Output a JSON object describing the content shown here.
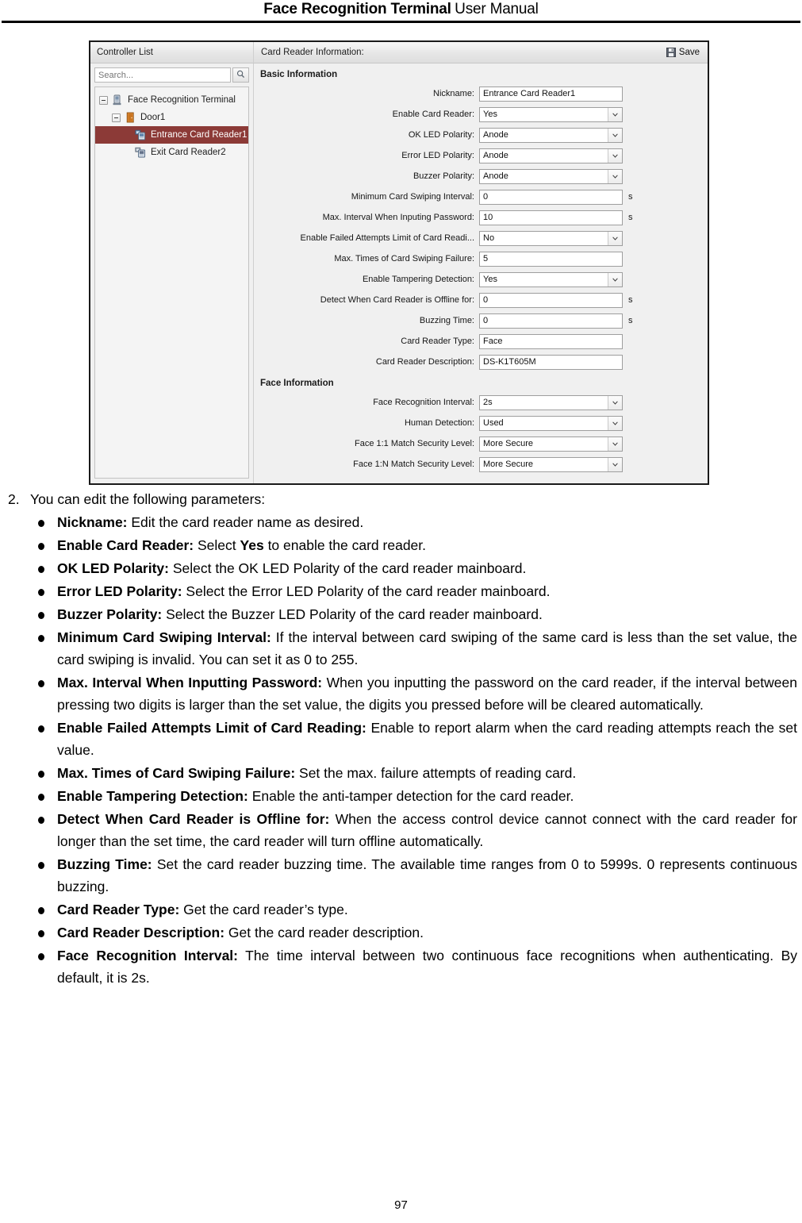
{
  "document": {
    "header_title_bold": "Face Recognition Terminal",
    "header_title_regular": "User Manual",
    "page_number": "97"
  },
  "app": {
    "left_panel": {
      "title": "Controller List",
      "search": {
        "placeholder": "Search...",
        "value": "",
        "icon": "search-icon"
      },
      "tree": [
        {
          "label": "Face Recognition Terminal",
          "level": 0,
          "icon": "terminal-device-icon",
          "expanded": true,
          "selected": false
        },
        {
          "label": "Door1",
          "level": 1,
          "icon": "door-icon",
          "expanded": true,
          "selected": false
        },
        {
          "label": "Entrance Card Reader1",
          "level": 2,
          "icon": "card-reader-icon",
          "expanded": null,
          "selected": true
        },
        {
          "label": "Exit Card Reader2",
          "level": 2,
          "icon": "card-reader-icon",
          "expanded": null,
          "selected": false
        }
      ]
    },
    "right_panel": {
      "title": "Card Reader Information:",
      "save_label": "Save",
      "save_icon": "floppy-disk-icon",
      "groups": [
        {
          "title": "Basic Information",
          "fields": [
            {
              "label": "Nickname:",
              "value": "Entrance Card Reader1",
              "control": "text",
              "unit": ""
            },
            {
              "label": "Enable Card Reader:",
              "value": "Yes",
              "control": "select",
              "unit": ""
            },
            {
              "label": "OK LED Polarity:",
              "value": "Anode",
              "control": "select",
              "unit": ""
            },
            {
              "label": "Error LED Polarity:",
              "value": "Anode",
              "control": "select",
              "unit": ""
            },
            {
              "label": "Buzzer Polarity:",
              "value": "Anode",
              "control": "select",
              "unit": ""
            },
            {
              "label": "Minimum Card Swiping Interval:",
              "value": "0",
              "control": "text",
              "unit": "s"
            },
            {
              "label": "Max. Interval When Inputing Password:",
              "value": "10",
              "control": "text",
              "unit": "s"
            },
            {
              "label": "Enable Failed Attempts Limit of Card Readi...",
              "value": "No",
              "control": "select",
              "unit": ""
            },
            {
              "label": "Max. Times of Card Swiping Failure:",
              "value": "5",
              "control": "text",
              "unit": ""
            },
            {
              "label": "Enable Tampering Detection:",
              "value": "Yes",
              "control": "select",
              "unit": ""
            },
            {
              "label": "Detect When Card Reader is Offline for:",
              "value": "0",
              "control": "text",
              "unit": "s"
            },
            {
              "label": "Buzzing Time:",
              "value": "0",
              "control": "text",
              "unit": "s"
            },
            {
              "label": "Card Reader Type:",
              "value": "Face",
              "control": "text",
              "unit": ""
            },
            {
              "label": "Card Reader Description:",
              "value": "DS-K1T605M",
              "control": "text",
              "unit": ""
            }
          ]
        },
        {
          "title": "Face Information",
          "fields": [
            {
              "label": "Face Recognition Interval:",
              "value": "2s",
              "control": "select",
              "unit": ""
            },
            {
              "label": "Human Detection:",
              "value": "Used",
              "control": "select",
              "unit": ""
            },
            {
              "label": "Face 1:1 Match Security Level:",
              "value": "More Secure",
              "control": "select",
              "unit": ""
            },
            {
              "label": "Face 1:N Match Security Level:",
              "value": "More Secure",
              "control": "select",
              "unit": ""
            }
          ]
        }
      ]
    }
  },
  "instructions": {
    "step_number": "2.",
    "step_text": "You can edit the following parameters:",
    "bullets": [
      {
        "term": "Nickname:",
        "desc": " Edit the card reader name as desired.",
        "justify": false
      },
      {
        "term": "Enable Card Reader:",
        "desc": " Select ",
        "desc_bold": "Yes",
        "desc_tail": " to enable the card reader.",
        "justify": false
      },
      {
        "term": "OK LED Polarity:",
        "desc": " Select the OK LED Polarity of the card reader mainboard.",
        "justify": false
      },
      {
        "term": "Error LED Polarity:",
        "desc": " Select the Error LED Polarity of the card reader mainboard.",
        "justify": false
      },
      {
        "term": "Buzzer Polarity:",
        "desc": " Select the Buzzer LED Polarity of the card reader mainboard.",
        "justify": false
      },
      {
        "term": "Minimum Card Swiping Interval:",
        "desc": " If the interval between card swiping of the same card is less than the set value, the card swiping is invalid. You can set it as 0 to 255.",
        "justify": true
      },
      {
        "term": "Max. Interval When Inputting Password:",
        "desc": " When you inputting the password on the card reader, if the interval between pressing two digits is larger than the set value, the digits you pressed before will be cleared automatically.",
        "justify": true
      },
      {
        "term": "Enable Failed Attempts Limit of Card Reading:",
        "desc": " Enable to report alarm when the card reading attempts reach the set value.",
        "justify": true
      },
      {
        "term": "Max. Times of Card Swiping Failure:",
        "desc": " Set the max. failure attempts of reading card.",
        "justify": false
      },
      {
        "term": "Enable Tampering Detection:",
        "desc": " Enable the anti-tamper detection for the card reader.",
        "justify": false
      },
      {
        "term": "Detect When Card Reader is Offline for:",
        "desc": " When the access control device cannot connect with the card reader for longer than the set time, the card reader will turn offline automatically.",
        "justify": true
      },
      {
        "term": "Buzzing Time:",
        "desc": " Set the card reader buzzing time. The available time ranges from 0 to 5999s. 0 represents continuous buzzing.",
        "justify": true
      },
      {
        "term": "Card Reader Type:",
        "desc": " Get the card reader’s type.",
        "justify": false
      },
      {
        "term": "Card Reader Description:",
        "desc": " Get the card reader description.",
        "justify": false
      },
      {
        "term": "Face Recognition Interval:",
        "desc": " The time interval between two continuous face recognitions when authenticating. By default, it is 2s.",
        "justify": true
      }
    ]
  },
  "colors": {
    "selection": "#8c3a37",
    "panel_bg": "#f0f0f0",
    "field_border": "#9e9e9e"
  }
}
